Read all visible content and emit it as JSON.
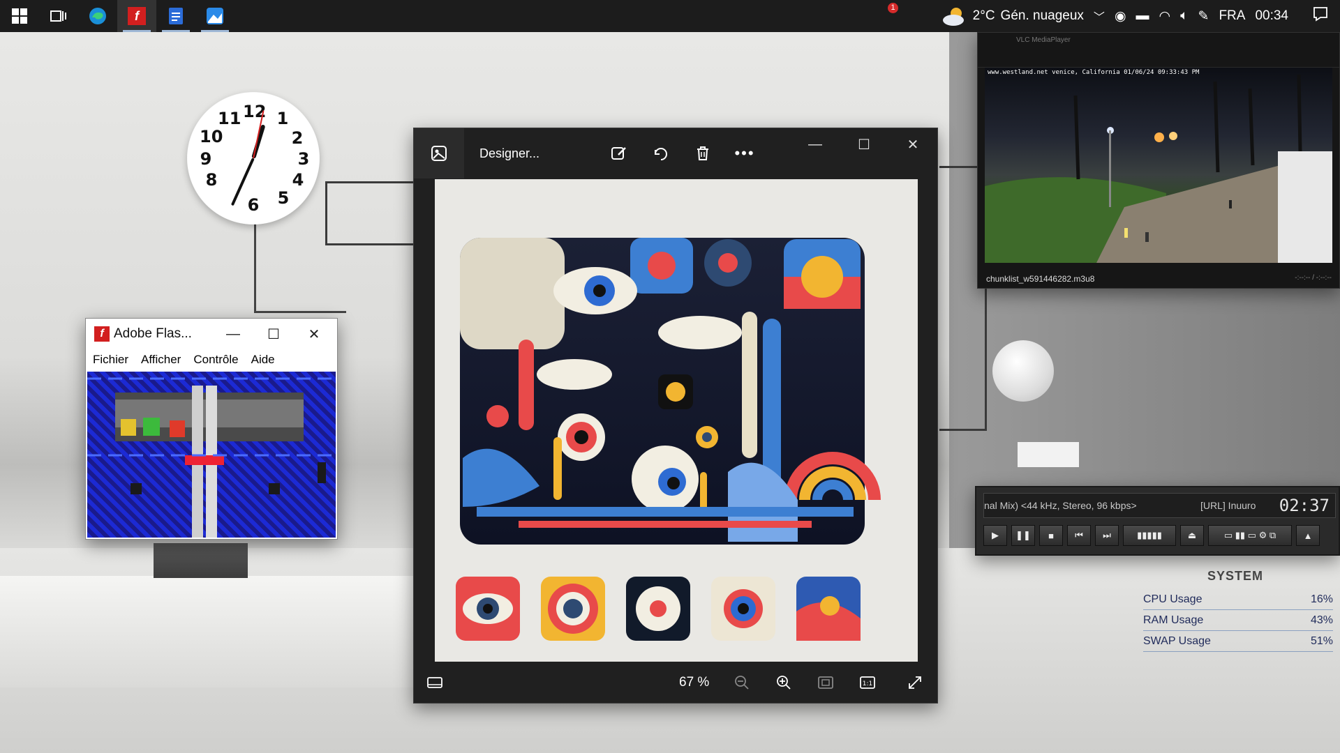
{
  "taskbar": {
    "apps": [
      {
        "name": "windows-start",
        "label": ""
      },
      {
        "name": "task-view",
        "label": ""
      },
      {
        "name": "edge",
        "label": ""
      },
      {
        "name": "adobe-flash",
        "label": ""
      },
      {
        "name": "docs",
        "label": ""
      },
      {
        "name": "photos",
        "label": ""
      }
    ],
    "weather_badge": "1",
    "weather_temp": "2°C",
    "weather_text": "Gén. nuageux",
    "language": "FRA",
    "time": "00:34"
  },
  "flash_window": {
    "title": "Adobe Flas...",
    "menu": [
      "Fichier",
      "Afficher",
      "Contrôle",
      "Aide"
    ],
    "accent": "#d21f1f"
  },
  "photos_window": {
    "title": "Designer...",
    "zoom": "67 %",
    "tools": [
      "edit-icon",
      "rotate-icon",
      "delete-icon",
      "more-icon"
    ]
  },
  "vlc_window": {
    "title": "VLC MediaPlayer",
    "osd": "www.westland.net  venice, California  01/06/24  09:33:43 PM",
    "file": "chunklist_w591446282.m3u8",
    "time": "-:--:-- / -:--:--"
  },
  "player": {
    "display_left": "nal Mix) <44 kHz, Stereo, 96 kbps>",
    "display_right": "[URL] Inuuro",
    "time": "02:37"
  },
  "sysmon": {
    "title": "SYSTEM",
    "rows": [
      {
        "label": "CPU Usage",
        "value": "16%"
      },
      {
        "label": "RAM Usage",
        "value": "43%"
      },
      {
        "label": "SWAP Usage",
        "value": "51%"
      }
    ]
  },
  "clock": {
    "hour": 12,
    "minute": 34,
    "second": 2
  }
}
